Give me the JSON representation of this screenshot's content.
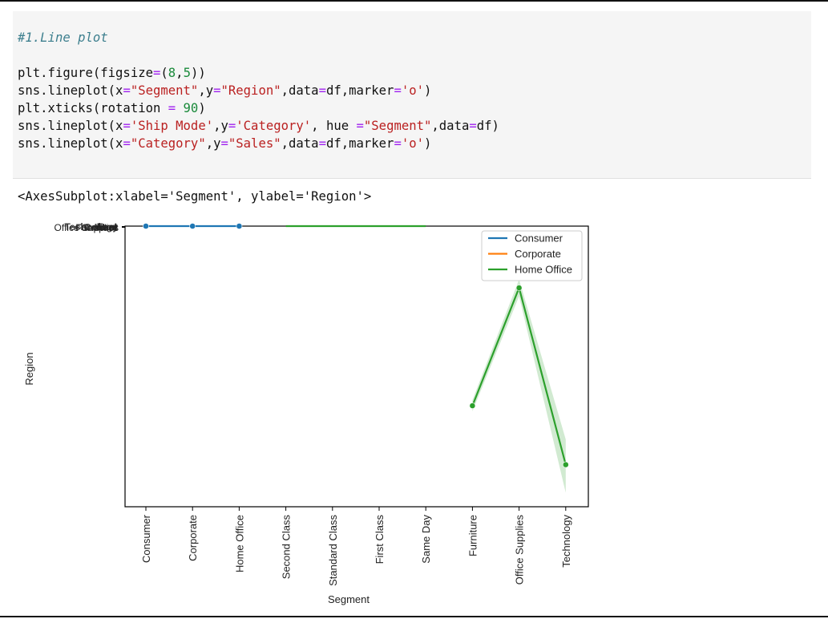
{
  "notebook": {
    "code_lines": [
      [
        {
          "t": "#1.Line plot",
          "c": "cmt"
        }
      ],
      [],
      [
        {
          "t": "plt.figure(figsize"
        },
        {
          "t": "=",
          "c": "op"
        },
        {
          "t": "("
        },
        {
          "t": "8",
          "c": "num"
        },
        {
          "t": ","
        },
        {
          "t": "5",
          "c": "num"
        },
        {
          "t": "))"
        }
      ],
      [
        {
          "t": "sns.lineplot(x"
        },
        {
          "t": "=",
          "c": "op"
        },
        {
          "t": "\"Segment\"",
          "c": "str"
        },
        {
          "t": ",y"
        },
        {
          "t": "=",
          "c": "op"
        },
        {
          "t": "\"Region\"",
          "c": "str"
        },
        {
          "t": ",data"
        },
        {
          "t": "=",
          "c": "op"
        },
        {
          "t": "df,marker"
        },
        {
          "t": "=",
          "c": "op"
        },
        {
          "t": "'o'",
          "c": "str"
        },
        {
          "t": ")"
        }
      ],
      [
        {
          "t": "plt.xticks(rotation "
        },
        {
          "t": "=",
          "c": "op"
        },
        {
          "t": " "
        },
        {
          "t": "90",
          "c": "num"
        },
        {
          "t": ")"
        }
      ],
      [
        {
          "t": "sns.lineplot(x"
        },
        {
          "t": "=",
          "c": "op"
        },
        {
          "t": "'Ship Mode'",
          "c": "str"
        },
        {
          "t": ",y"
        },
        {
          "t": "=",
          "c": "op"
        },
        {
          "t": "'Category'",
          "c": "str"
        },
        {
          "t": ", hue "
        },
        {
          "t": "=",
          "c": "op"
        },
        {
          "t": "\"Segment\"",
          "c": "str"
        },
        {
          "t": ",data"
        },
        {
          "t": "=",
          "c": "op"
        },
        {
          "t": "df)"
        }
      ],
      [
        {
          "t": "sns.lineplot(x"
        },
        {
          "t": "=",
          "c": "op"
        },
        {
          "t": "\"Category\"",
          "c": "str"
        },
        {
          "t": ",y"
        },
        {
          "t": "=",
          "c": "op"
        },
        {
          "t": "\"Sales\"",
          "c": "str"
        },
        {
          "t": ",data"
        },
        {
          "t": "=",
          "c": "op"
        },
        {
          "t": "df,marker"
        },
        {
          "t": "=",
          "c": "op"
        },
        {
          "t": "'o'",
          "c": "str"
        },
        {
          "t": ")"
        }
      ]
    ],
    "output_text": "<AxesSubplot:xlabel='Segment', ylabel='Region'>"
  },
  "colors": {
    "blue": "#1f77b4",
    "orange": "#ff7f0e",
    "green": "#2ca02c"
  },
  "chart_data": {
    "type": "line",
    "xlabel": "Segment",
    "ylabel": "Region",
    "categories": [
      "Consumer",
      "Corporate",
      "Home Office",
      "Second Class",
      "Standard Class",
      "First Class",
      "Same Day",
      "Furniture",
      "Office Supplies",
      "Technology"
    ],
    "ytick_label_overlap": "Office Supplies / Central / East / South / West / Technology / Furniture (overlapping)",
    "series": [
      {
        "categories": [
          "Consumer",
          "Corporate",
          "Home Office"
        ],
        "values": [
          0,
          0,
          0
        ],
        "color": "#1f77b4",
        "marker": true
      },
      {
        "categories": [
          "Second Class",
          "Standard Class",
          "First Class",
          "Same Day"
        ],
        "values": [
          0,
          0,
          0,
          0
        ],
        "color": "#2ca02c",
        "marker": false
      },
      {
        "categories": [
          "Furniture",
          "Office Supplies",
          "Technology"
        ],
        "values": [
          0.64,
          0.22,
          0.85
        ],
        "ci_low": [
          0.62,
          0.19,
          0.76
        ],
        "ci_high": [
          0.66,
          0.25,
          0.95
        ],
        "color": "#2ca02c",
        "marker": true
      }
    ],
    "legend": {
      "placement": "top-right",
      "entries": [
        {
          "label": "Consumer",
          "color": "#1f77b4"
        },
        {
          "label": "Corporate",
          "color": "#ff7f0e"
        },
        {
          "label": "Home Office",
          "color": "#2ca02c"
        }
      ]
    },
    "ylim": [
      0,
      1
    ]
  }
}
